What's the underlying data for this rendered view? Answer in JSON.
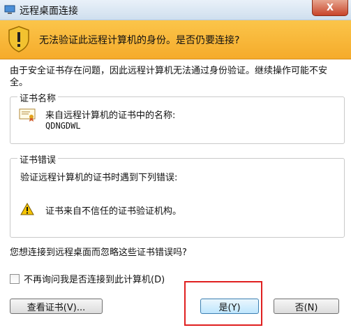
{
  "window": {
    "title": "远程桌面连接",
    "close_label": "X"
  },
  "banner": {
    "text": "无法验证此远程计算机的身份。是否仍要连接?"
  },
  "description": "由于安全证书存在问题，因此远程计算机无法通过身份验证。继续操作可能不安全。",
  "cert_group": {
    "title": "证书名称",
    "label": "来自远程计算机的证书中的名称:",
    "name": "QDNGDWL"
  },
  "error_group": {
    "title": "证书错误",
    "label": "验证远程计算机的证书时遇到下列错误:",
    "error": "证书来自不信任的证书验证机构。"
  },
  "question": "您想连接到远程桌面而忽略这些证书错误吗?",
  "checkbox": {
    "label": "不再询问我是否连接到此计算机(D)",
    "checked": false
  },
  "buttons": {
    "view_cert": "查看证书(V)...",
    "yes": "是(Y)",
    "no": "否(N)"
  },
  "colors": {
    "banner": "#f8b83a",
    "highlight": "#e02020"
  },
  "icons": [
    "remote-desktop-icon",
    "shield-warning-icon",
    "certificate-icon",
    "warning-icon"
  ]
}
